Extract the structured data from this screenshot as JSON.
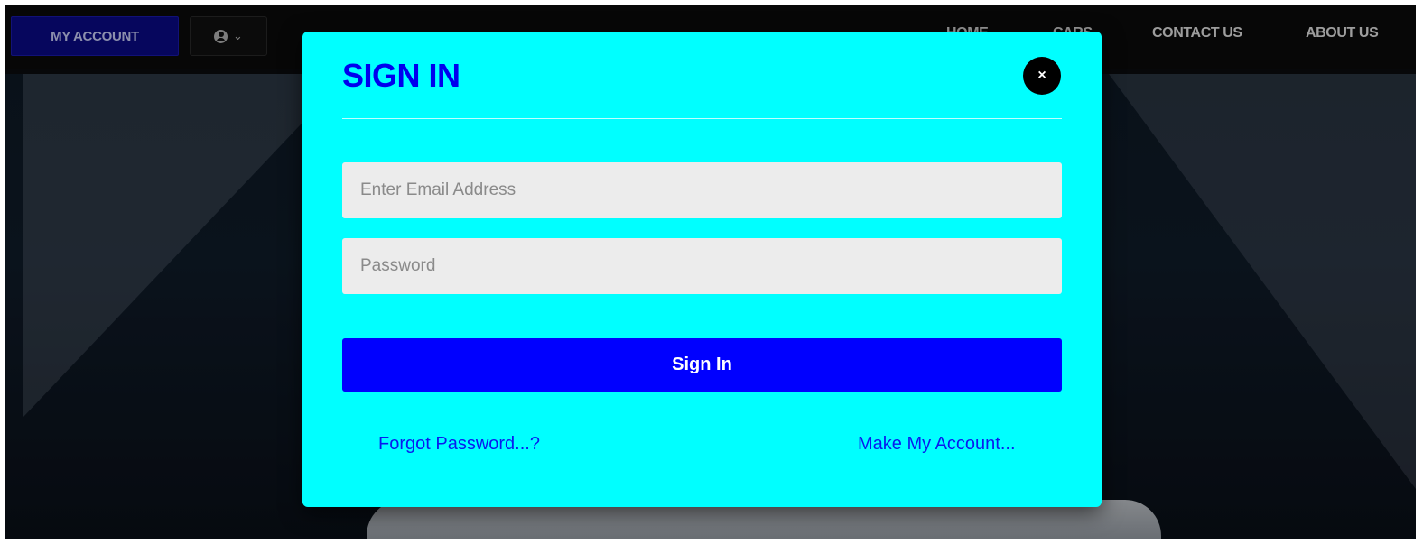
{
  "header": {
    "my_account_label": "MY ACCOUNT",
    "user_dropdown_icon": "user-circle-icon",
    "user_dropdown_caret": "chevron-down-icon",
    "nav": [
      {
        "label": "HOME"
      },
      {
        "label": "CARS"
      },
      {
        "label": "CONTACT US"
      },
      {
        "label": "ABOUT US"
      }
    ]
  },
  "modal": {
    "title": "SIGN IN",
    "close_label": "×",
    "email_placeholder": "Enter Email Address",
    "password_placeholder": "Password",
    "submit_label": "Sign In",
    "forgot_label": "Forgot Password...?",
    "register_label": "Make My Account..."
  },
  "colors": {
    "modal_background": "#00FFFF",
    "title": "#0000EE",
    "primary_button": "#0000FF",
    "my_account_button": "#0A0A8A",
    "close_button": "#000000"
  }
}
